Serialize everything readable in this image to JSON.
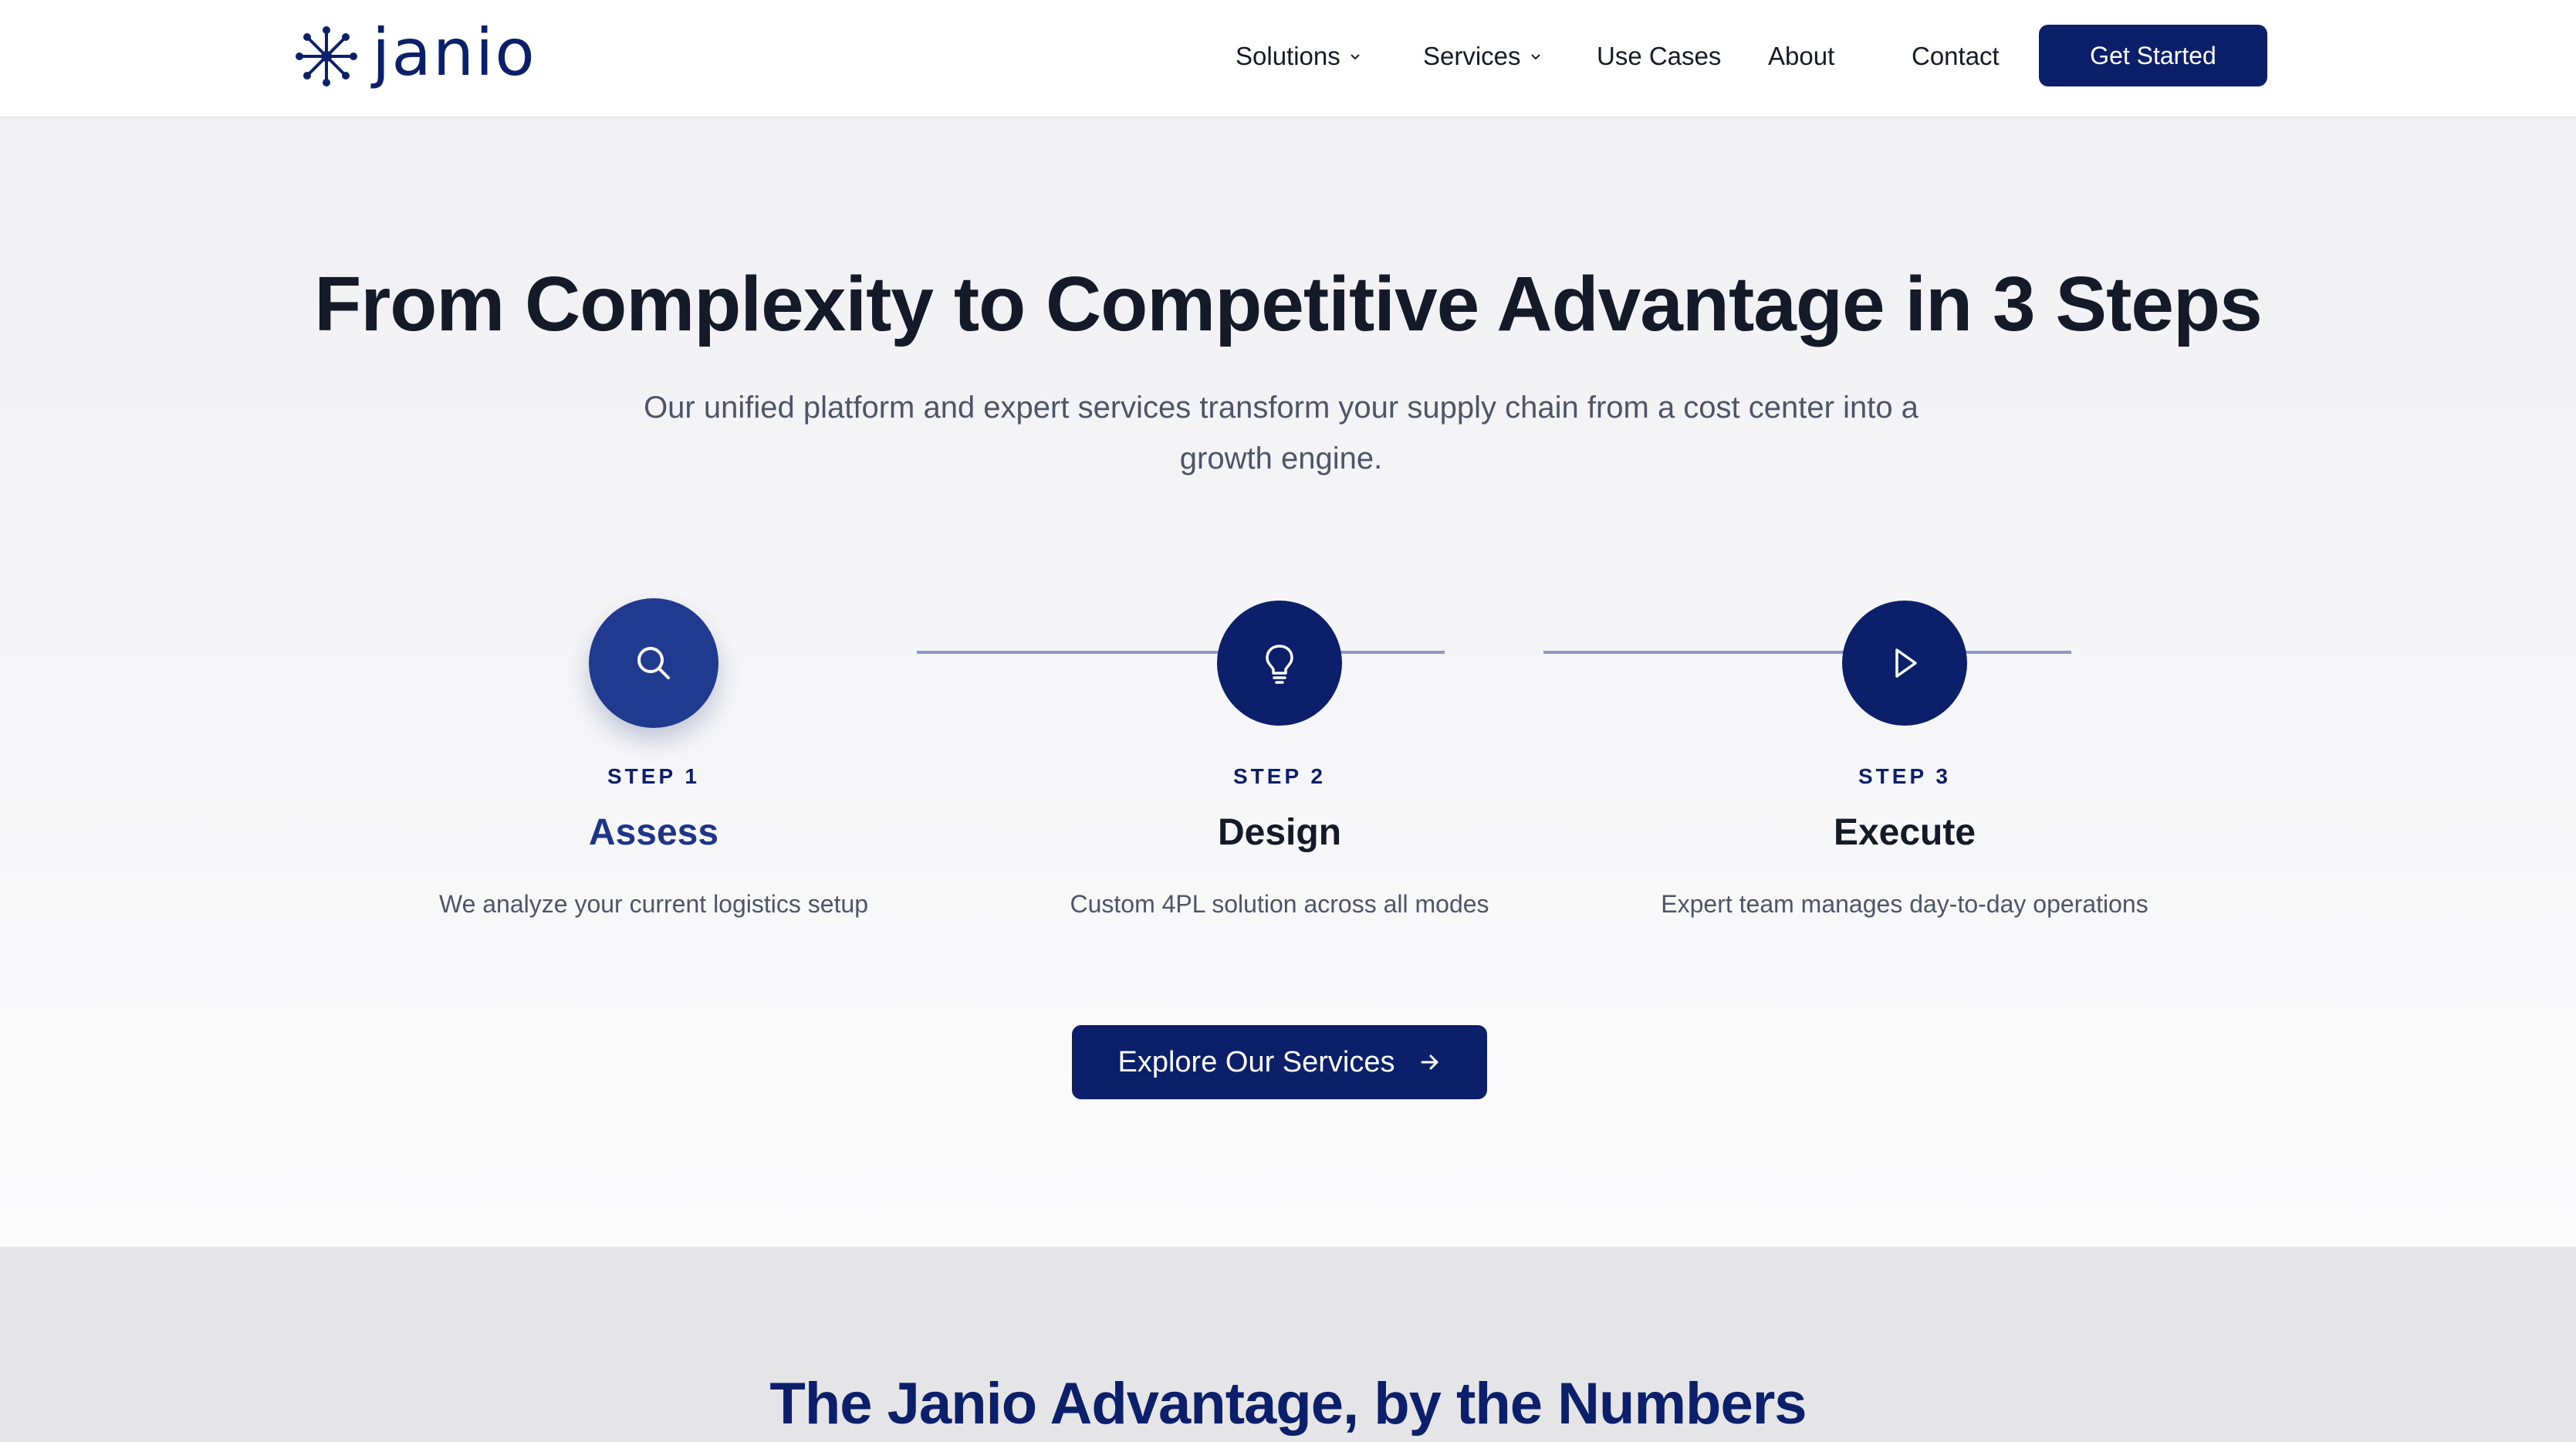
{
  "brand": {
    "name": "janio",
    "accent_color": "#0b1f6b"
  },
  "nav": {
    "items": [
      {
        "label": "Solutions",
        "has_dropdown": true
      },
      {
        "label": "Services",
        "has_dropdown": true
      },
      {
        "label": "Use Cases",
        "has_dropdown": false
      },
      {
        "label": "About",
        "has_dropdown": false
      },
      {
        "label": "Contact",
        "has_dropdown": false
      }
    ],
    "cta_label": "Get Started"
  },
  "hero": {
    "title": "From Complexity to Competitive Advantage in 3 Steps",
    "subtitle": "Our unified platform and expert services transform your supply chain from a cost center into a growth engine."
  },
  "steps": [
    {
      "label": "STEP 1",
      "title": "Assess",
      "description": "We analyze your current logistics setup",
      "icon": "search-icon"
    },
    {
      "label": "STEP 2",
      "title": "Design",
      "description": "Custom 4PL solution across all modes",
      "icon": "lightbulb-icon"
    },
    {
      "label": "STEP 3",
      "title": "Execute",
      "description": "Expert team manages day-to-day operations",
      "icon": "play-icon"
    }
  ],
  "explore_button": {
    "label": "Explore Our Services",
    "icon": "arrow-right-icon"
  },
  "numbers_section": {
    "title": "The Janio Advantage, by the Numbers"
  }
}
